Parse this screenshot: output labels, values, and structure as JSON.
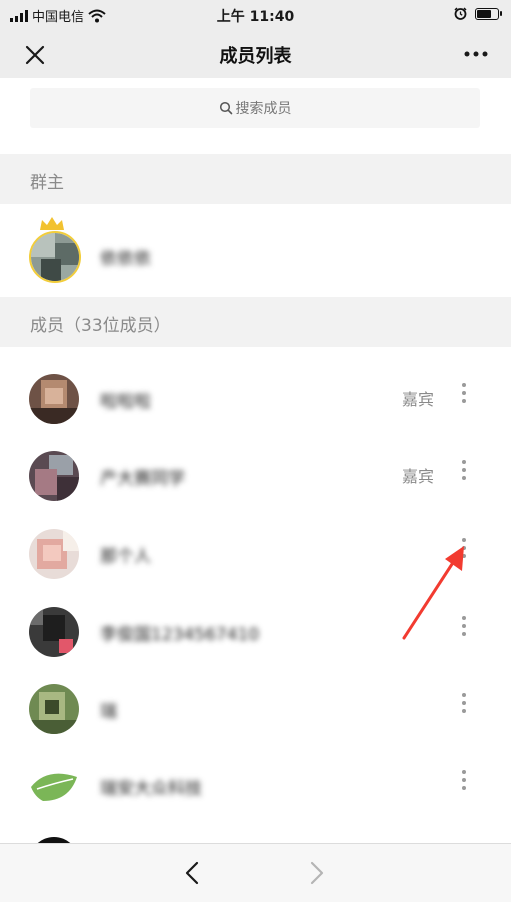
{
  "status_bar": {
    "carrier": "中国电信",
    "time": "上午 11:40",
    "battery_level": 0.7
  },
  "nav": {
    "title": "成员列表"
  },
  "search": {
    "placeholder": "搜索成员"
  },
  "sections": {
    "owner_header": "群主",
    "members_header": "成员（33位成员）"
  },
  "owner": {
    "name": "依依依"
  },
  "members": [
    {
      "name": "啦啦啦",
      "tag": "嘉宾"
    },
    {
      "name": "产大赛同学",
      "tag": "嘉宾"
    },
    {
      "name": "那个人",
      "tag": ""
    },
    {
      "name": "李俊国1234567410",
      "tag": ""
    },
    {
      "name": "瑞",
      "tag": ""
    },
    {
      "name": "瑞安大众科技",
      "tag": ""
    }
  ],
  "colors": {
    "crown": "#f2c230",
    "annotation_arrow": "#f23b30",
    "section_bg": "#f2f2f2",
    "nav_bg": "#ededed"
  },
  "icons": {
    "close": "close-icon",
    "more": "more-icon",
    "search": "search-icon",
    "member_menu": "more-vertical-icon",
    "back": "chevron-left-icon",
    "forward": "chevron-right-icon"
  }
}
